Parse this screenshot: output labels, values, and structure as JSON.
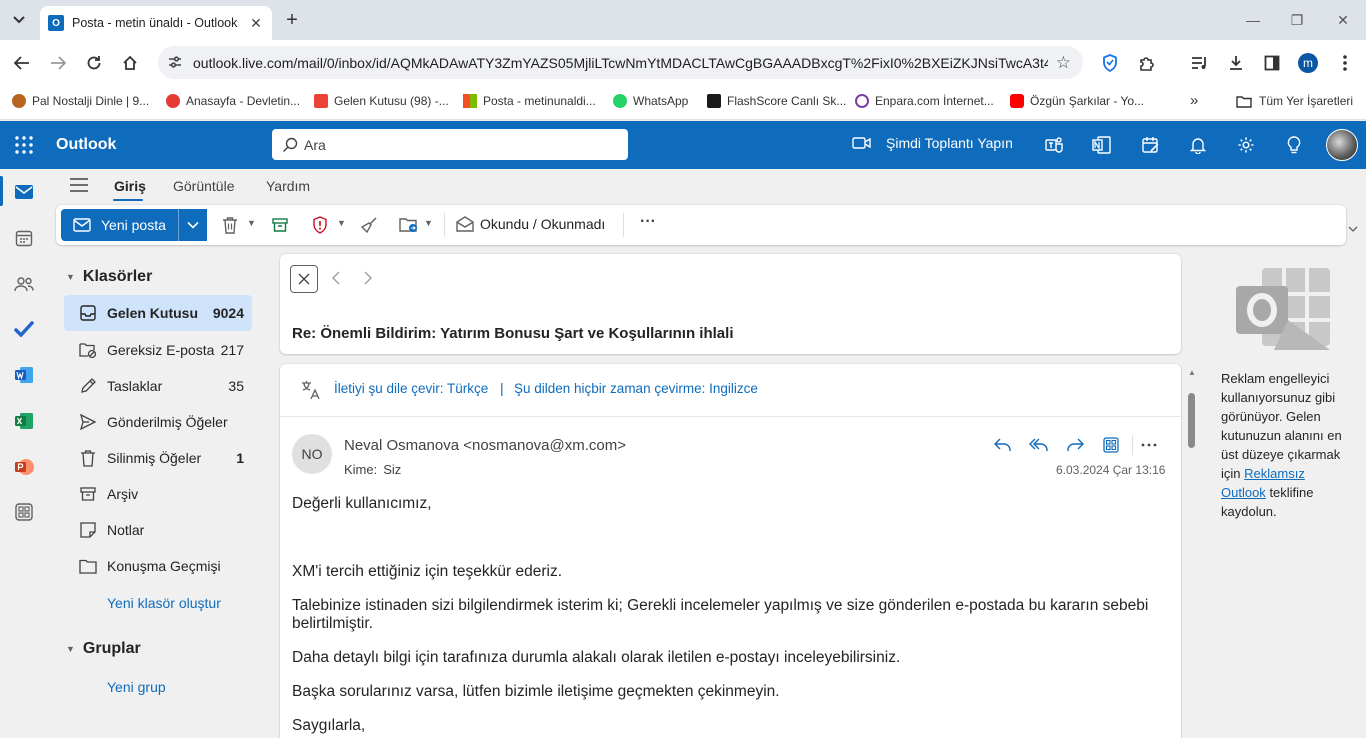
{
  "browser": {
    "tab_title": "Posta - metin ünaldı - Outlook",
    "tab_favicon": "O",
    "url": "outlook.live.com/mail/0/inbox/id/AQMkADAwATY3ZmYAZS05MjliLTcwNmYtMDACLTAwCgBGAAADBxcgT%2FixI0%2BXEiZKJNsiTwcA3t4A...",
    "profile_initial": "m",
    "bookmarks": [
      {
        "label": "Pal Nostalji Dinle | 9...",
        "color": "#c0392b"
      },
      {
        "label": "Anasayfa - Devletin...",
        "color": "#e53935"
      },
      {
        "label": "Gelen Kutusu (98) -...",
        "color": "#ea4335"
      },
      {
        "label": "Posta - metinunaldi...",
        "color": "#f25022"
      },
      {
        "label": "WhatsApp",
        "color": "#25d366"
      },
      {
        "label": "FlashScore Canlı Sk...",
        "color": "#1a1a1a"
      },
      {
        "label": "Enpara.com İnternet...",
        "color": "#7b3fa0"
      },
      {
        "label": "Özgün Şarkılar - Yo...",
        "color": "#ff0000"
      }
    ],
    "bookmarks_more": "»",
    "all_bookmarks": "Tüm Yer İşaretleri"
  },
  "outlook": {
    "brand": "Outlook",
    "search_placeholder": "Ara",
    "meet_now": "Şimdi Toplantı Yapın",
    "accent": "#0f6cbd"
  },
  "ribbon": {
    "tabs": [
      "Giriş",
      "Görüntüle",
      "Yardım"
    ],
    "new_mail": "Yeni posta",
    "read_unread": "Okundu / Okunmadı",
    "more": "···"
  },
  "folders": {
    "header": "Klasörler",
    "items": [
      {
        "label": "Gelen Kutusu",
        "count": "9024"
      },
      {
        "label": "Gereksiz E-posta",
        "count": "217"
      },
      {
        "label": "Taslaklar",
        "count": "35"
      },
      {
        "label": "Gönderilmiş Öğeler",
        "count": ""
      },
      {
        "label": "Silinmiş Öğeler",
        "count": "1"
      },
      {
        "label": "Arşiv",
        "count": ""
      },
      {
        "label": "Notlar",
        "count": ""
      },
      {
        "label": "Konuşma Geçmişi",
        "count": ""
      }
    ],
    "new_folder": "Yeni klasör oluştur",
    "groups_header": "Gruplar",
    "new_group": "Yeni grup"
  },
  "message": {
    "subject": "Re: Önemli Bildirim: Yatırım Bonusu Şart ve Koşullarının ihlali",
    "translate_link": "İletiyi şu dile çevir: Türkçe",
    "translate_sep": "|",
    "never_translate_link": "Şu dilden hiçbir zaman çevirme: Ingilizce",
    "sender_initials": "NO",
    "sender": "Neval Osmanova <nosmanova@xm.com>",
    "to_label": "Kime:",
    "to_value": "Siz",
    "date": "6.03.2024 Çar 13:16",
    "body": {
      "greeting": "Değerli kullanıcımız,",
      "p1": "XM'i tercih ettiğiniz için teşekkür ederiz.",
      "p2": "Talebinize istinaden sizi bilgilendirmek isterim ki; Gerekli incelemeler yapılmış ve size gönderilen e-postada bu kararın sebebi belirtilmiştir.",
      "p3": "Daha detaylı bilgi için tarafınıza durumla alakalı olarak iletilen e-postayı inceleyebilirsiniz.",
      "p4": "Başka sorularınız varsa, lütfen bizimle iletişime geçmekten çekinmeyin.",
      "closing": "Saygılarla,"
    }
  },
  "ad": {
    "text_before": "Reklam engelleyici kullanıyorsunuz gibi görünüyor. Gelen kutunuzun alanını en üst düzeye çıkarmak için",
    "link": "Reklamsız Outlook",
    "text_after": "teklifine kaydolun."
  }
}
